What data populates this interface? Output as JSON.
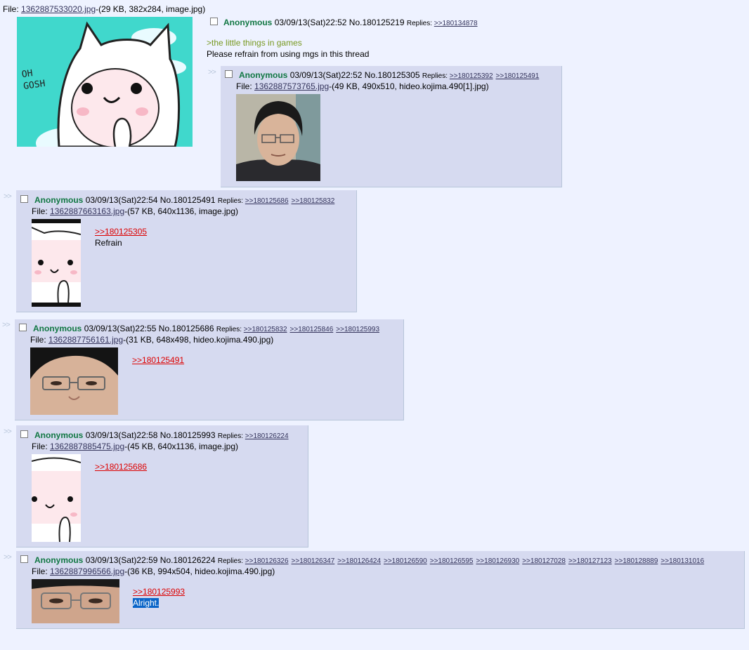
{
  "op": {
    "file_label": "File: ",
    "file_name": "1362887533020.jpg",
    "file_meta": "-(29 KB, 382x284, image.jpg)",
    "name": "Anonymous",
    "datetime": "03/09/13(Sat)22:52",
    "no": "No.180125219",
    "replies_label": "Replies:",
    "replies": [
      ">>180134878"
    ],
    "greentext": ">the little things in games",
    "text": "Please refrain from using mgs in this thread",
    "thumb_text": "OH\nGOSH"
  },
  "posts": [
    {
      "name": "Anonymous",
      "datetime": "03/09/13(Sat)22:52",
      "no": "No.180125305",
      "replies_label": "Replies:",
      "replies": [
        ">>180125392",
        ">>180125491"
      ],
      "file_label": "File: ",
      "file_name": "1362887573765.jpg",
      "file_meta": "-(49 KB, 490x510, hideo.kojima.490[1].jpg)"
    },
    {
      "name": "Anonymous",
      "datetime": "03/09/13(Sat)22:54",
      "no": "No.180125491",
      "replies_label": "Replies:",
      "replies": [
        ">>180125686",
        ">>180125832"
      ],
      "file_label": "File: ",
      "file_name": "1362887663163.jpg",
      "file_meta": "-(57 KB, 640x1136, image.jpg)",
      "quote": ">>180125305",
      "text": "Refrain"
    },
    {
      "name": "Anonymous",
      "datetime": "03/09/13(Sat)22:55",
      "no": "No.180125686",
      "replies_label": "Replies:",
      "replies": [
        ">>180125832",
        ">>180125846",
        ">>180125993"
      ],
      "file_label": "File: ",
      "file_name": "1362887756161.jpg",
      "file_meta": "-(31 KB, 648x498, hideo.kojima.490.jpg)",
      "quote": ">>180125491"
    },
    {
      "name": "Anonymous",
      "datetime": "03/09/13(Sat)22:58",
      "no": "No.180125993",
      "replies_label": "Replies:",
      "replies": [
        ">>180126224"
      ],
      "file_label": "File: ",
      "file_name": "1362887885475.jpg",
      "file_meta": "-(45 KB, 640x1136, image.jpg)",
      "quote": ">>180125686"
    },
    {
      "name": "Anonymous",
      "datetime": "03/09/13(Sat)22:59",
      "no": "No.180126224",
      "replies_label": "Replies:",
      "replies": [
        ">>180126326",
        ">>180126347",
        ">>180126424",
        ">>180126590",
        ">>180126595",
        ">>180126930",
        ">>180127028",
        ">>180127123",
        ">>180128889",
        ">>180131016"
      ],
      "file_label": "File: ",
      "file_name": "1362887996566.jpg",
      "file_meta": "-(36 KB, 994x504, hideo.kojima.490.jpg)",
      "quote": ">>180125993",
      "text": "Alright."
    }
  ],
  "arrows": ">>",
  "colors": {
    "background": "#eef2ff",
    "reply_bg": "#d6daf0",
    "name": "#117743",
    "link": "#34345c",
    "quote": "#dd0000",
    "greentext": "#789922",
    "selection": "#0a64c8"
  }
}
